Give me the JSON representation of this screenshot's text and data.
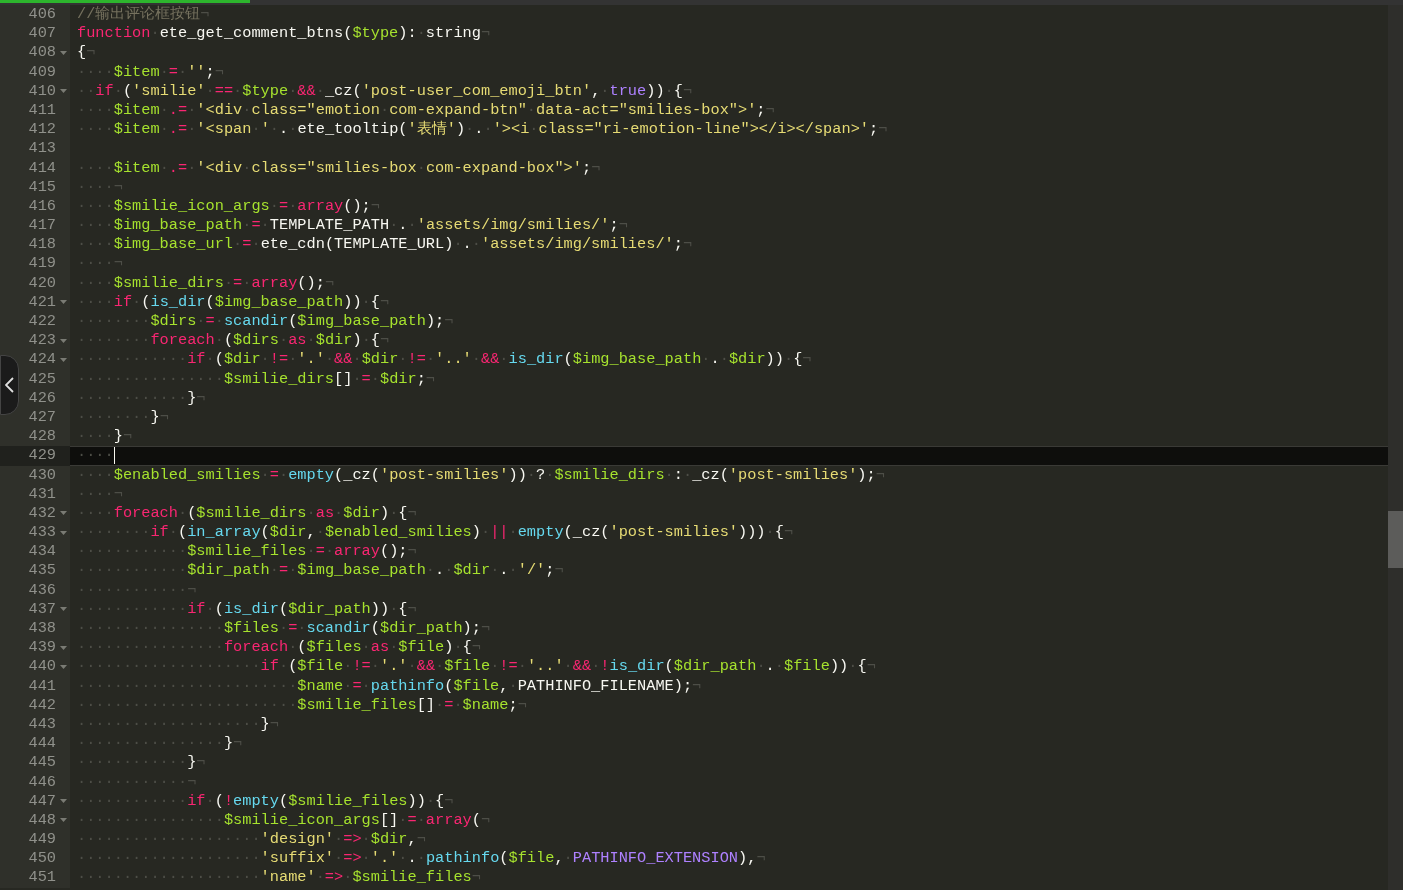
{
  "editor": {
    "lines": [
      {
        "number": "406",
        "foldable": false,
        "current": false,
        "tokens": [
          {
            "kind": "cmt",
            "text": "//输出评论框按钮"
          },
          {
            "kind": "text",
            "text": "¬"
          }
        ]
      },
      {
        "number": "407",
        "foldable": false,
        "current": false,
        "tokens": [
          {
            "kind": "kw",
            "text": "function"
          },
          {
            "kind": "text",
            "text": "·ete_get_comment_btns("
          },
          {
            "kind": "var",
            "text": "$type"
          },
          {
            "kind": "text",
            "text": "):·string¬"
          }
        ]
      },
      {
        "number": "408",
        "foldable": true,
        "current": false,
        "tokens": [
          {
            "kind": "text",
            "text": "{¬"
          }
        ]
      },
      {
        "number": "409",
        "foldable": false,
        "current": false,
        "tokens": [
          {
            "kind": "text",
            "text": "····"
          },
          {
            "kind": "var",
            "text": "$item"
          },
          {
            "kind": "text",
            "text": "·"
          },
          {
            "kind": "kw",
            "text": "="
          },
          {
            "kind": "text",
            "text": "·"
          },
          {
            "kind": "str",
            "text": "''"
          },
          {
            "kind": "text",
            "text": ";¬"
          }
        ]
      },
      {
        "number": "410",
        "foldable": true,
        "current": false,
        "tokens": [
          {
            "kind": "text",
            "text": "··"
          },
          {
            "kind": "kw",
            "text": "if"
          },
          {
            "kind": "text",
            "text": "·("
          },
          {
            "kind": "str",
            "text": "'smilie'"
          },
          {
            "kind": "text",
            "text": "·"
          },
          {
            "kind": "kw",
            "text": "=="
          },
          {
            "kind": "text",
            "text": "·"
          },
          {
            "kind": "var",
            "text": "$type"
          },
          {
            "kind": "text",
            "text": "·"
          },
          {
            "kind": "kw",
            "text": "&&"
          },
          {
            "kind": "text",
            "text": "·_cz("
          },
          {
            "kind": "str",
            "text": "'post-user_com_emoji_btn'"
          },
          {
            "kind": "text",
            "text": ",·"
          },
          {
            "kind": "const",
            "text": "true"
          },
          {
            "kind": "text",
            "text": "))·{¬"
          }
        ]
      },
      {
        "number": "411",
        "foldable": false,
        "current": false,
        "tokens": [
          {
            "kind": "text",
            "text": "····"
          },
          {
            "kind": "var",
            "text": "$item"
          },
          {
            "kind": "text",
            "text": "·"
          },
          {
            "kind": "kw",
            "text": ".="
          },
          {
            "kind": "text",
            "text": "·"
          },
          {
            "kind": "str",
            "text": "'<div·class=\"emotion·com-expand-btn\"·data-act=\"smilies-box\">'"
          },
          {
            "kind": "text",
            "text": ";¬"
          }
        ]
      },
      {
        "number": "412",
        "foldable": false,
        "current": false,
        "tokens": [
          {
            "kind": "text",
            "text": "····"
          },
          {
            "kind": "var",
            "text": "$item"
          },
          {
            "kind": "text",
            "text": "·"
          },
          {
            "kind": "kw",
            "text": ".="
          },
          {
            "kind": "text",
            "text": "·"
          },
          {
            "kind": "str",
            "text": "'<span·'"
          },
          {
            "kind": "text",
            "text": "·.·ete_tooltip("
          },
          {
            "kind": "str",
            "text": "'表情'"
          },
          {
            "kind": "text",
            "text": ")·.·"
          },
          {
            "kind": "str",
            "text": "'><i·class=\"ri-emotion-line\"></i></span>'"
          },
          {
            "kind": "text",
            "text": ";¬"
          }
        ]
      },
      {
        "number": "413",
        "foldable": false,
        "current": false
      },
      {
        "number": "414",
        "foldable": false,
        "current": false,
        "tokens": [
          {
            "kind": "text",
            "text": "····"
          },
          {
            "kind": "var",
            "text": "$item"
          },
          {
            "kind": "text",
            "text": "·"
          },
          {
            "kind": "kw",
            "text": ".="
          },
          {
            "kind": "text",
            "text": "·"
          },
          {
            "kind": "str",
            "text": "'<div·class=\"smilies-box·com-expand-box\">'"
          },
          {
            "kind": "text",
            "text": ";¬"
          }
        ]
      },
      {
        "number": "415",
        "foldable": false,
        "current": false,
        "tokens": [
          {
            "kind": "text",
            "text": "····¬"
          }
        ]
      },
      {
        "number": "416",
        "foldable": false,
        "current": false,
        "tokens": [
          {
            "kind": "text",
            "text": "····"
          },
          {
            "kind": "var",
            "text": "$smilie_icon_args"
          },
          {
            "kind": "text",
            "text": "·"
          },
          {
            "kind": "kw",
            "text": "="
          },
          {
            "kind": "text",
            "text": "·"
          },
          {
            "kind": "kw",
            "text": "array"
          },
          {
            "kind": "text",
            "text": "();¬"
          }
        ]
      },
      {
        "number": "417",
        "foldable": false,
        "current": false,
        "tokens": [
          {
            "kind": "text",
            "text": "····"
          },
          {
            "kind": "var",
            "text": "$img_base_path"
          },
          {
            "kind": "text",
            "text": "·"
          },
          {
            "kind": "kw",
            "text": "="
          },
          {
            "kind": "text",
            "text": "·TEMPLATE_PATH·.·"
          },
          {
            "kind": "str",
            "text": "'assets/img/smilies/'"
          },
          {
            "kind": "text",
            "text": ";¬"
          }
        ]
      },
      {
        "number": "418",
        "foldable": false,
        "current": false,
        "tokens": [
          {
            "kind": "text",
            "text": "····"
          },
          {
            "kind": "var",
            "text": "$img_base_url"
          },
          {
            "kind": "text",
            "text": "·"
          },
          {
            "kind": "kw",
            "text": "="
          },
          {
            "kind": "text",
            "text": "·ete_cdn(TEMPLATE_URL)·.·"
          },
          {
            "kind": "str",
            "text": "'assets/img/smilies/'"
          },
          {
            "kind": "text",
            "text": ";¬"
          }
        ]
      },
      {
        "number": "419",
        "foldable": false,
        "current": false,
        "tokens": [
          {
            "kind": "text",
            "text": "····¬"
          }
        ]
      },
      {
        "number": "420",
        "foldable": false,
        "current": false,
        "tokens": [
          {
            "kind": "text",
            "text": "····"
          },
          {
            "kind": "var",
            "text": "$smilie_dirs"
          },
          {
            "kind": "text",
            "text": "·"
          },
          {
            "kind": "kw",
            "text": "="
          },
          {
            "kind": "text",
            "text": "·"
          },
          {
            "kind": "kw",
            "text": "array"
          },
          {
            "kind": "text",
            "text": "();¬"
          }
        ]
      },
      {
        "number": "421",
        "foldable": true,
        "current": false,
        "tokens": [
          {
            "kind": "text",
            "text": "····"
          },
          {
            "kind": "kw",
            "text": "if"
          },
          {
            "kind": "text",
            "text": "·("
          },
          {
            "kind": "fn",
            "text": "is_dir"
          },
          {
            "kind": "text",
            "text": "("
          },
          {
            "kind": "var",
            "text": "$img_base_path"
          },
          {
            "kind": "text",
            "text": "))·{¬"
          }
        ]
      },
      {
        "number": "422",
        "foldable": false,
        "current": false,
        "tokens": [
          {
            "kind": "text",
            "text": "········"
          },
          {
            "kind": "var",
            "text": "$dirs"
          },
          {
            "kind": "text",
            "text": "·"
          },
          {
            "kind": "kw",
            "text": "="
          },
          {
            "kind": "text",
            "text": "·"
          },
          {
            "kind": "fn",
            "text": "scandir"
          },
          {
            "kind": "text",
            "text": "("
          },
          {
            "kind": "var",
            "text": "$img_base_path"
          },
          {
            "kind": "text",
            "text": ");¬"
          }
        ]
      },
      {
        "number": "423",
        "foldable": true,
        "current": false,
        "tokens": [
          {
            "kind": "text",
            "text": "········"
          },
          {
            "kind": "kw",
            "text": "foreach"
          },
          {
            "kind": "text",
            "text": "·("
          },
          {
            "kind": "var",
            "text": "$dirs"
          },
          {
            "kind": "text",
            "text": "·"
          },
          {
            "kind": "kw",
            "text": "as"
          },
          {
            "kind": "text",
            "text": "·"
          },
          {
            "kind": "var",
            "text": "$dir"
          },
          {
            "kind": "text",
            "text": ")·{¬"
          }
        ]
      },
      {
        "number": "424",
        "foldable": true,
        "current": false,
        "tokens": [
          {
            "kind": "text",
            "text": "············"
          },
          {
            "kind": "kw",
            "text": "if"
          },
          {
            "kind": "text",
            "text": "·("
          },
          {
            "kind": "var",
            "text": "$dir"
          },
          {
            "kind": "text",
            "text": "·"
          },
          {
            "kind": "kw",
            "text": "!="
          },
          {
            "kind": "text",
            "text": "·"
          },
          {
            "kind": "str",
            "text": "'.'"
          },
          {
            "kind": "text",
            "text": "·"
          },
          {
            "kind": "kw",
            "text": "&&"
          },
          {
            "kind": "text",
            "text": "·"
          },
          {
            "kind": "var",
            "text": "$dir"
          },
          {
            "kind": "text",
            "text": "·"
          },
          {
            "kind": "kw",
            "text": "!="
          },
          {
            "kind": "text",
            "text": "·"
          },
          {
            "kind": "str",
            "text": "'..'"
          },
          {
            "kind": "text",
            "text": "·"
          },
          {
            "kind": "kw",
            "text": "&&"
          },
          {
            "kind": "text",
            "text": "·"
          },
          {
            "kind": "fn",
            "text": "is_dir"
          },
          {
            "kind": "text",
            "text": "("
          },
          {
            "kind": "var",
            "text": "$img_base_path"
          },
          {
            "kind": "text",
            "text": "·.·"
          },
          {
            "kind": "var",
            "text": "$dir"
          },
          {
            "kind": "text",
            "text": "))·{¬"
          }
        ]
      },
      {
        "number": "425",
        "foldable": false,
        "current": false,
        "tokens": [
          {
            "kind": "text",
            "text": "················"
          },
          {
            "kind": "var",
            "text": "$smilie_dirs"
          },
          {
            "kind": "text",
            "text": "[]·"
          },
          {
            "kind": "kw",
            "text": "="
          },
          {
            "kind": "text",
            "text": "·"
          },
          {
            "kind": "var",
            "text": "$dir"
          },
          {
            "kind": "text",
            "text": ";¬"
          }
        ]
      },
      {
        "number": "426",
        "foldable": false,
        "current": false,
        "tokens": [
          {
            "kind": "text",
            "text": "············}¬"
          }
        ]
      },
      {
        "number": "427",
        "foldable": false,
        "current": false,
        "tokens": [
          {
            "kind": "text",
            "text": "········}¬"
          }
        ]
      },
      {
        "number": "428",
        "foldable": false,
        "current": false,
        "tokens": [
          {
            "kind": "text",
            "text": "····}¬"
          }
        ]
      },
      {
        "number": "429",
        "foldable": false,
        "current": true,
        "tokens": [
          {
            "kind": "text",
            "text": "····"
          }
        ]
      },
      {
        "number": "430",
        "foldable": false,
        "current": false,
        "tokens": [
          {
            "kind": "text",
            "text": "····"
          },
          {
            "kind": "var",
            "text": "$enabled_smilies"
          },
          {
            "kind": "text",
            "text": "·"
          },
          {
            "kind": "kw",
            "text": "="
          },
          {
            "kind": "text",
            "text": "·"
          },
          {
            "kind": "fn",
            "text": "empty"
          },
          {
            "kind": "text",
            "text": "(_cz("
          },
          {
            "kind": "str",
            "text": "'post-smilies'"
          },
          {
            "kind": "text",
            "text": "))·?·"
          },
          {
            "kind": "var",
            "text": "$smilie_dirs"
          },
          {
            "kind": "text",
            "text": "·:·_cz("
          },
          {
            "kind": "str",
            "text": "'post-smilies'"
          },
          {
            "kind": "text",
            "text": ");¬"
          }
        ]
      },
      {
        "number": "431",
        "foldable": false,
        "current": false,
        "tokens": [
          {
            "kind": "text",
            "text": "····¬"
          }
        ]
      },
      {
        "number": "432",
        "foldable": true,
        "current": false,
        "tokens": [
          {
            "kind": "text",
            "text": "····"
          },
          {
            "kind": "kw",
            "text": "foreach"
          },
          {
            "kind": "text",
            "text": "·("
          },
          {
            "kind": "var",
            "text": "$smilie_dirs"
          },
          {
            "kind": "text",
            "text": "·"
          },
          {
            "kind": "kw",
            "text": "as"
          },
          {
            "kind": "text",
            "text": "·"
          },
          {
            "kind": "var",
            "text": "$dir"
          },
          {
            "kind": "text",
            "text": ")·{¬"
          }
        ]
      },
      {
        "number": "433",
        "foldable": true,
        "current": false,
        "tokens": [
          {
            "kind": "text",
            "text": "········"
          },
          {
            "kind": "kw",
            "text": "if"
          },
          {
            "kind": "text",
            "text": "·("
          },
          {
            "kind": "fn",
            "text": "in_array"
          },
          {
            "kind": "text",
            "text": "("
          },
          {
            "kind": "var",
            "text": "$dir"
          },
          {
            "kind": "text",
            "text": ",·"
          },
          {
            "kind": "var",
            "text": "$enabled_smilies"
          },
          {
            "kind": "text",
            "text": ")·"
          },
          {
            "kind": "kw",
            "text": "||"
          },
          {
            "kind": "text",
            "text": "·"
          },
          {
            "kind": "fn",
            "text": "empty"
          },
          {
            "kind": "text",
            "text": "(_cz("
          },
          {
            "kind": "str",
            "text": "'post-smilies'"
          },
          {
            "kind": "text",
            "text": ")))·{¬"
          }
        ]
      },
      {
        "number": "434",
        "foldable": false,
        "current": false,
        "tokens": [
          {
            "kind": "text",
            "text": "············"
          },
          {
            "kind": "var",
            "text": "$smilie_files"
          },
          {
            "kind": "text",
            "text": "·"
          },
          {
            "kind": "kw",
            "text": "="
          },
          {
            "kind": "text",
            "text": "·"
          },
          {
            "kind": "kw",
            "text": "array"
          },
          {
            "kind": "text",
            "text": "();¬"
          }
        ]
      },
      {
        "number": "435",
        "foldable": false,
        "current": false,
        "tokens": [
          {
            "kind": "text",
            "text": "············"
          },
          {
            "kind": "var",
            "text": "$dir_path"
          },
          {
            "kind": "text",
            "text": "·"
          },
          {
            "kind": "kw",
            "text": "="
          },
          {
            "kind": "text",
            "text": "·"
          },
          {
            "kind": "var",
            "text": "$img_base_path"
          },
          {
            "kind": "text",
            "text": "·.·"
          },
          {
            "kind": "var",
            "text": "$dir"
          },
          {
            "kind": "text",
            "text": "·.·"
          },
          {
            "kind": "str",
            "text": "'/'"
          },
          {
            "kind": "text",
            "text": ";¬"
          }
        ]
      },
      {
        "number": "436",
        "foldable": false,
        "current": false,
        "tokens": [
          {
            "kind": "text",
            "text": "············¬"
          }
        ]
      },
      {
        "number": "437",
        "foldable": true,
        "current": false,
        "tokens": [
          {
            "kind": "text",
            "text": "············"
          },
          {
            "kind": "kw",
            "text": "if"
          },
          {
            "kind": "text",
            "text": "·("
          },
          {
            "kind": "fn",
            "text": "is_dir"
          },
          {
            "kind": "text",
            "text": "("
          },
          {
            "kind": "var",
            "text": "$dir_path"
          },
          {
            "kind": "text",
            "text": "))·{¬"
          }
        ]
      },
      {
        "number": "438",
        "foldable": false,
        "current": false,
        "tokens": [
          {
            "kind": "text",
            "text": "················"
          },
          {
            "kind": "var",
            "text": "$files"
          },
          {
            "kind": "text",
            "text": "·"
          },
          {
            "kind": "kw",
            "text": "="
          },
          {
            "kind": "text",
            "text": "·"
          },
          {
            "kind": "fn",
            "text": "scandir"
          },
          {
            "kind": "text",
            "text": "("
          },
          {
            "kind": "var",
            "text": "$dir_path"
          },
          {
            "kind": "text",
            "text": ");¬"
          }
        ]
      },
      {
        "number": "439",
        "foldable": true,
        "current": false,
        "tokens": [
          {
            "kind": "text",
            "text": "················"
          },
          {
            "kind": "kw",
            "text": "foreach"
          },
          {
            "kind": "text",
            "text": "·("
          },
          {
            "kind": "var",
            "text": "$files"
          },
          {
            "kind": "text",
            "text": "·"
          },
          {
            "kind": "kw",
            "text": "as"
          },
          {
            "kind": "text",
            "text": "·"
          },
          {
            "kind": "var",
            "text": "$file"
          },
          {
            "kind": "text",
            "text": ")·{¬"
          }
        ]
      },
      {
        "number": "440",
        "foldable": true,
        "current": false,
        "tokens": [
          {
            "kind": "text",
            "text": "····················"
          },
          {
            "kind": "kw",
            "text": "if"
          },
          {
            "kind": "text",
            "text": "·("
          },
          {
            "kind": "var",
            "text": "$file"
          },
          {
            "kind": "text",
            "text": "·"
          },
          {
            "kind": "kw",
            "text": "!="
          },
          {
            "kind": "text",
            "text": "·"
          },
          {
            "kind": "str",
            "text": "'.'"
          },
          {
            "kind": "text",
            "text": "·"
          },
          {
            "kind": "kw",
            "text": "&&"
          },
          {
            "kind": "text",
            "text": "·"
          },
          {
            "kind": "var",
            "text": "$file"
          },
          {
            "kind": "text",
            "text": "·"
          },
          {
            "kind": "kw",
            "text": "!="
          },
          {
            "kind": "text",
            "text": "·"
          },
          {
            "kind": "str",
            "text": "'..'"
          },
          {
            "kind": "text",
            "text": "·"
          },
          {
            "kind": "kw",
            "text": "&&"
          },
          {
            "kind": "text",
            "text": "·"
          },
          {
            "kind": "kw",
            "text": "!"
          },
          {
            "kind": "fn",
            "text": "is_dir"
          },
          {
            "kind": "text",
            "text": "("
          },
          {
            "kind": "var",
            "text": "$dir_path"
          },
          {
            "kind": "text",
            "text": "·.·"
          },
          {
            "kind": "var",
            "text": "$file"
          },
          {
            "kind": "text",
            "text": "))·{¬"
          }
        ]
      },
      {
        "number": "441",
        "foldable": false,
        "current": false,
        "tokens": [
          {
            "kind": "text",
            "text": "························"
          },
          {
            "kind": "var",
            "text": "$name"
          },
          {
            "kind": "text",
            "text": "·"
          },
          {
            "kind": "kw",
            "text": "="
          },
          {
            "kind": "text",
            "text": "·"
          },
          {
            "kind": "fn",
            "text": "pathinfo"
          },
          {
            "kind": "text",
            "text": "("
          },
          {
            "kind": "var",
            "text": "$file"
          },
          {
            "kind": "text",
            "text": ",·PATHINFO_FILENAME);¬"
          }
        ]
      },
      {
        "number": "442",
        "foldable": false,
        "current": false,
        "tokens": [
          {
            "kind": "text",
            "text": "························"
          },
          {
            "kind": "var",
            "text": "$smilie_files"
          },
          {
            "kind": "text",
            "text": "[]·"
          },
          {
            "kind": "kw",
            "text": "="
          },
          {
            "kind": "text",
            "text": "·"
          },
          {
            "kind": "var",
            "text": "$name"
          },
          {
            "kind": "text",
            "text": ";¬"
          }
        ]
      },
      {
        "number": "443",
        "foldable": false,
        "current": false,
        "tokens": [
          {
            "kind": "text",
            "text": "····················}¬"
          }
        ]
      },
      {
        "number": "444",
        "foldable": false,
        "current": false,
        "tokens": [
          {
            "kind": "text",
            "text": "················}¬"
          }
        ]
      },
      {
        "number": "445",
        "foldable": false,
        "current": false,
        "tokens": [
          {
            "kind": "text",
            "text": "············}¬"
          }
        ]
      },
      {
        "number": "446",
        "foldable": false,
        "current": false,
        "tokens": [
          {
            "kind": "text",
            "text": "············¬"
          }
        ]
      },
      {
        "number": "447",
        "foldable": true,
        "current": false,
        "tokens": [
          {
            "kind": "text",
            "text": "············"
          },
          {
            "kind": "kw",
            "text": "if"
          },
          {
            "kind": "text",
            "text": "·("
          },
          {
            "kind": "kw",
            "text": "!"
          },
          {
            "kind": "fn",
            "text": "empty"
          },
          {
            "kind": "text",
            "text": "("
          },
          {
            "kind": "var",
            "text": "$smilie_files"
          },
          {
            "kind": "text",
            "text": "))·{¬"
          }
        ]
      },
      {
        "number": "448",
        "foldable": true,
        "current": false,
        "tokens": [
          {
            "kind": "text",
            "text": "················"
          },
          {
            "kind": "var",
            "text": "$smilie_icon_args"
          },
          {
            "kind": "text",
            "text": "[]·"
          },
          {
            "kind": "kw",
            "text": "="
          },
          {
            "kind": "text",
            "text": "·"
          },
          {
            "kind": "kw",
            "text": "array"
          },
          {
            "kind": "text",
            "text": "(¬"
          }
        ]
      },
      {
        "number": "449",
        "foldable": false,
        "current": false,
        "tokens": [
          {
            "kind": "text",
            "text": "····················"
          },
          {
            "kind": "str",
            "text": "'design'"
          },
          {
            "kind": "text",
            "text": "·"
          },
          {
            "kind": "kw",
            "text": "=>"
          },
          {
            "kind": "text",
            "text": "·"
          },
          {
            "kind": "var",
            "text": "$dir"
          },
          {
            "kind": "text",
            "text": ",¬"
          }
        ]
      },
      {
        "number": "450",
        "foldable": false,
        "current": false,
        "tokens": [
          {
            "kind": "text",
            "text": "····················"
          },
          {
            "kind": "str",
            "text": "'suffix'"
          },
          {
            "kind": "text",
            "text": "·"
          },
          {
            "kind": "kw",
            "text": "=>"
          },
          {
            "kind": "text",
            "text": "·"
          },
          {
            "kind": "str",
            "text": "'.'"
          },
          {
            "kind": "text",
            "text": "·.·"
          },
          {
            "kind": "fn",
            "text": "pathinfo"
          },
          {
            "kind": "text",
            "text": "("
          },
          {
            "kind": "var",
            "text": "$file"
          },
          {
            "kind": "text",
            "text": ",·"
          },
          {
            "kind": "const",
            "text": "PATHINFO_EXTENSION"
          },
          {
            "kind": "text",
            "text": "),¬"
          }
        ]
      },
      {
        "number": "451",
        "foldable": false,
        "current": false,
        "tokens": [
          {
            "kind": "text",
            "text": "····················"
          },
          {
            "kind": "str",
            "text": "'name'"
          },
          {
            "kind": "text",
            "text": "·"
          },
          {
            "kind": "kw",
            "text": "=>"
          },
          {
            "kind": "text",
            "text": "·"
          },
          {
            "kind": "var",
            "text": "$smilie_files"
          },
          {
            "kind": "text",
            "text": "¬"
          }
        ]
      }
    ]
  }
}
